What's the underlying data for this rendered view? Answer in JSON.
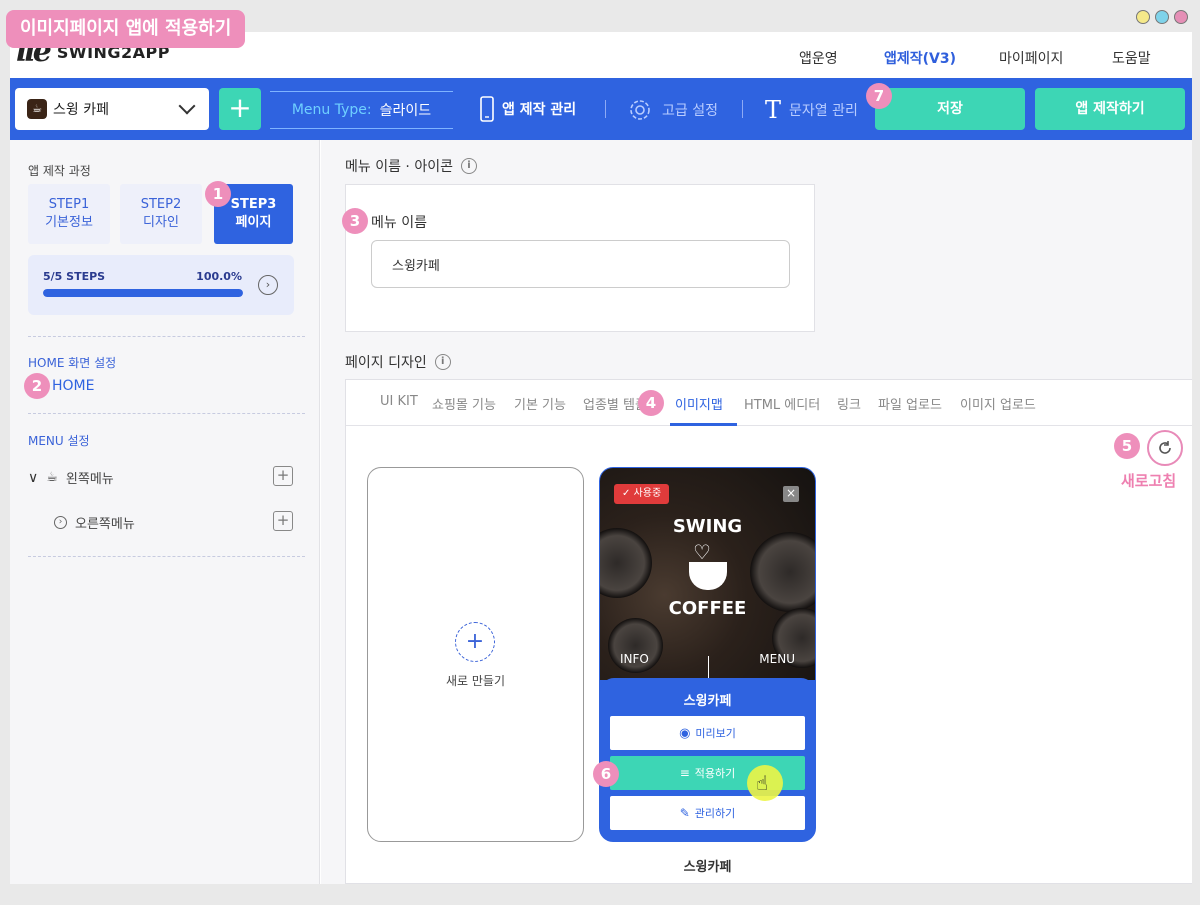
{
  "tutorial": {
    "title": "이미지페이지 앱에 적용하기",
    "markers": [
      "1",
      "2",
      "3",
      "4",
      "5",
      "6",
      "7"
    ]
  },
  "colors": {
    "primary": "#2f63e0",
    "accent": "#3dd6b5",
    "marker": "#ee8fbb",
    "badge": "#e03b3b"
  },
  "nav": {
    "logo": "SWING2APP",
    "items": [
      "앱운영",
      "앱제작(V3)",
      "마이페이지",
      "도움말"
    ],
    "active_index": 1
  },
  "toolbar": {
    "app_select": "스윙 카페",
    "add_label": "+",
    "menu_type_label": "Menu Type:",
    "menu_type_value": "슬라이드",
    "tools": [
      "앱 제작 관리",
      "고급 설정",
      "문자열 관리"
    ],
    "save": "저장",
    "build": "앱 제작하기"
  },
  "sidebar": {
    "process_title": "앱 제작 과정",
    "steps": [
      {
        "line1": "STEP1",
        "line2": "기본정보"
      },
      {
        "line1": "STEP2",
        "line2": "디자인"
      },
      {
        "line1": "STEP3",
        "line2": "페이지"
      }
    ],
    "progress": {
      "label": "5/5 STEPS",
      "percent_text": "100.0%",
      "value": 1.0
    },
    "home_section": "HOME 화면 설정",
    "home_link": "HOME",
    "menu_section": "MENU 설정",
    "menus": [
      "왼쪽메뉴",
      "오른쪽메뉴"
    ]
  },
  "main": {
    "menu_section_title": "메뉴 이름 · 아이콘",
    "menu_name_label": "메뉴 이름",
    "menu_name_value": "스윙카페",
    "design_section_title": "페이지 디자인",
    "tabs": [
      "UI KIT",
      "쇼핑몰 기능",
      "기본 기능",
      "업종별 템플릿",
      "이미지맵",
      "HTML 에디터",
      "링크",
      "파일 업로드",
      "이미지 업로드"
    ],
    "active_tab_index": 4,
    "refresh_label": "새로고침",
    "new_card_label": "새로 만들기",
    "template": {
      "badge": "사용중",
      "brand_top": "SWING",
      "brand_bottom": "COFFEE",
      "menu_left": "INFO",
      "menu_right": "MENU",
      "name": "스윙카페",
      "preview": "미리보기",
      "apply": "적용하기",
      "manage": "관리하기",
      "caption": "스윙카페"
    }
  }
}
